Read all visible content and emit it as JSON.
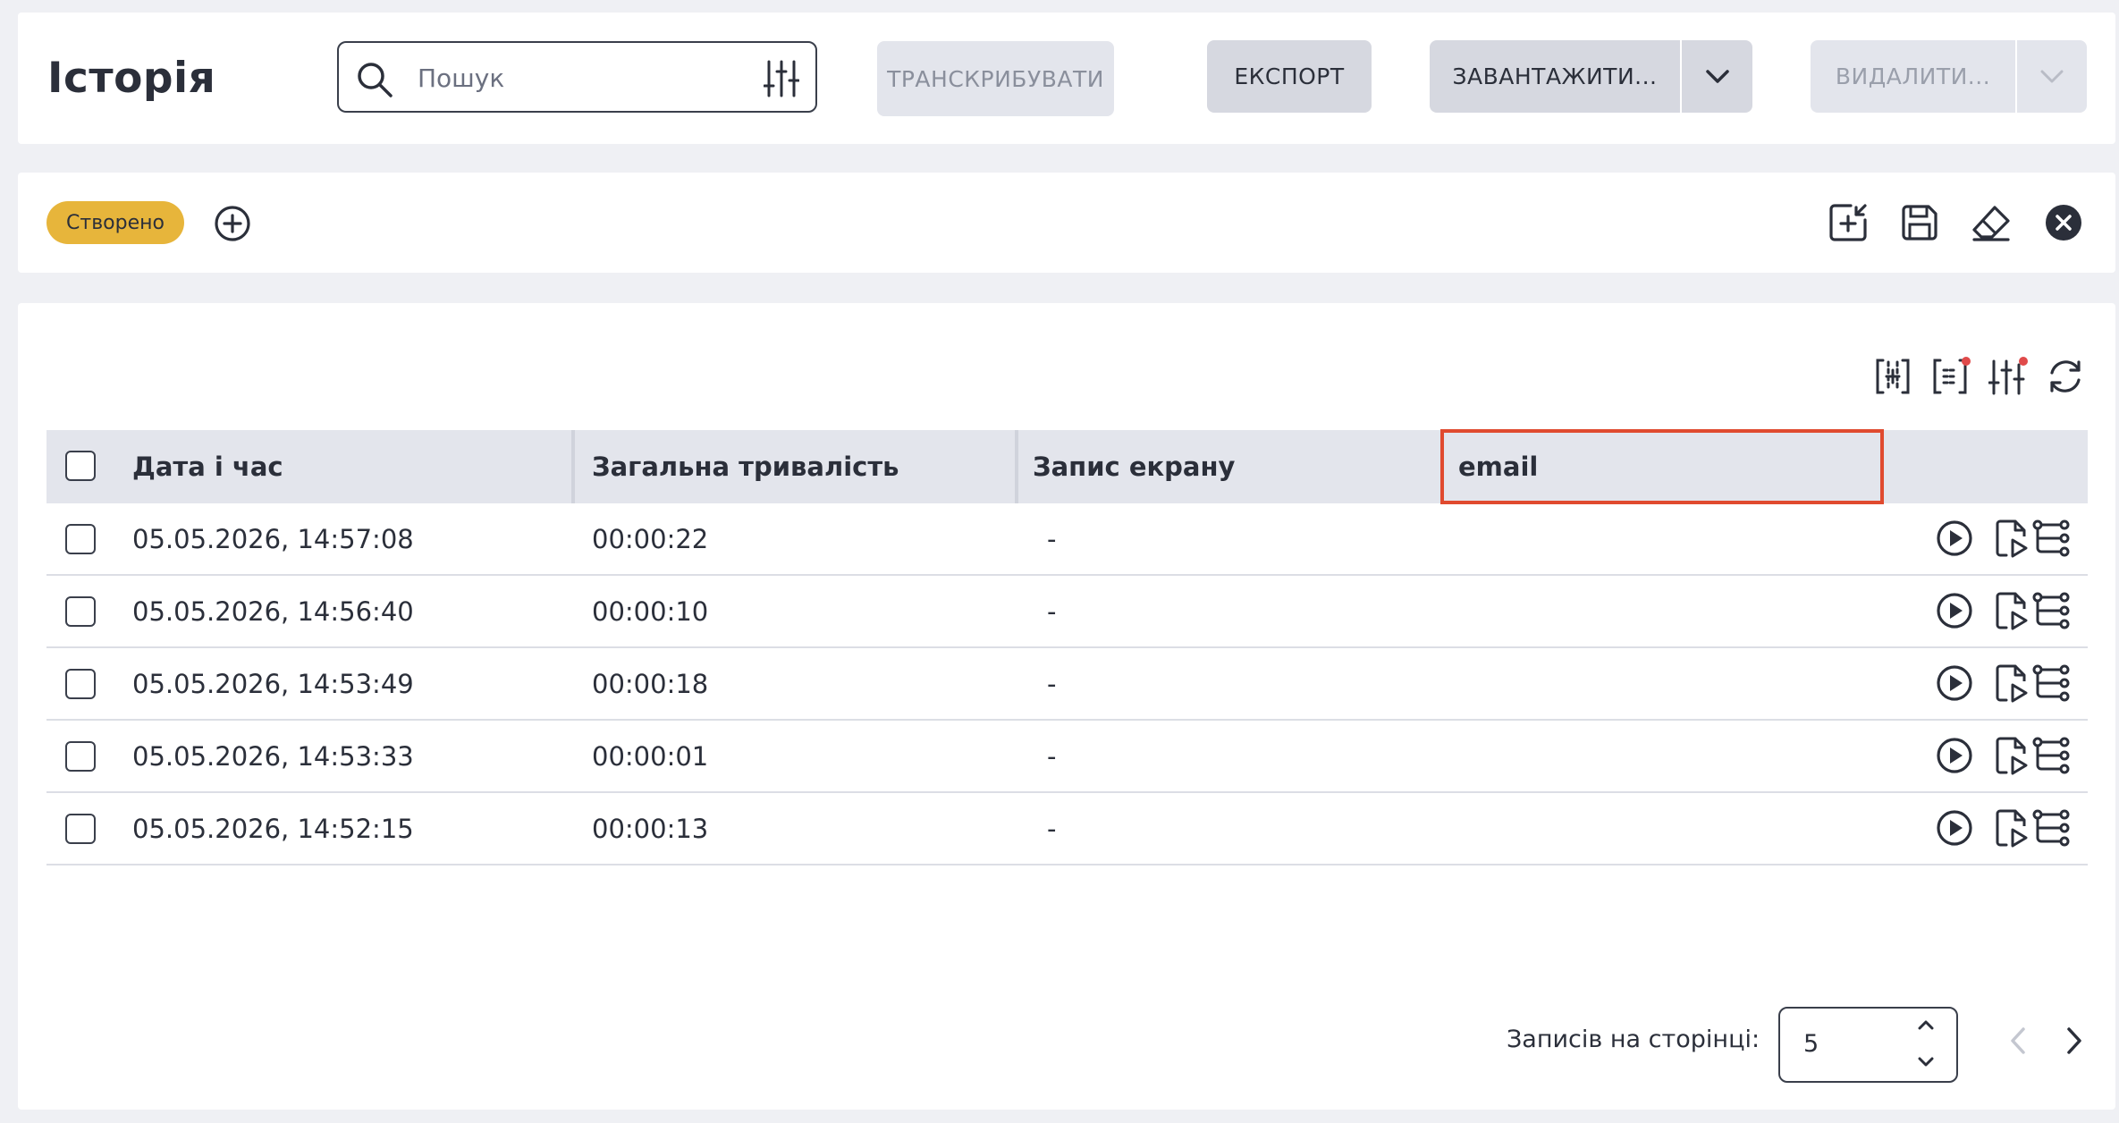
{
  "header": {
    "title": "Історія",
    "search": {
      "placeholder": "Пошук",
      "value": ""
    },
    "buttons": {
      "transcribe": "ТРАНСКРИБУВАТИ",
      "export": "ЕКСПОРТ",
      "download": "ЗАВАНТАЖИТИ...",
      "delete": "ВИДАЛИТИ..."
    }
  },
  "filters": {
    "chips": [
      "Створено"
    ]
  },
  "table": {
    "columns": [
      "Дата і час",
      "Загальна тривалість",
      "Запис екрану",
      "email"
    ],
    "rows": [
      {
        "datetime": "05.05.2026, 14:57:08",
        "duration": "00:00:22",
        "screen": "-",
        "email": ""
      },
      {
        "datetime": "05.05.2026, 14:56:40",
        "duration": "00:00:10",
        "screen": "-",
        "email": ""
      },
      {
        "datetime": "05.05.2026, 14:53:49",
        "duration": "00:00:18",
        "screen": "-",
        "email": ""
      },
      {
        "datetime": "05.05.2026, 14:53:33",
        "duration": "00:00:01",
        "screen": "-",
        "email": ""
      },
      {
        "datetime": "05.05.2026, 14:52:15",
        "duration": "00:00:13",
        "screen": "-",
        "email": ""
      }
    ]
  },
  "pagination": {
    "label": "Записів на сторінці:",
    "per_page": "5"
  },
  "colors": {
    "chip": "#e7b53b",
    "highlight": "#e04a2f",
    "badge": "#e04a4a"
  }
}
